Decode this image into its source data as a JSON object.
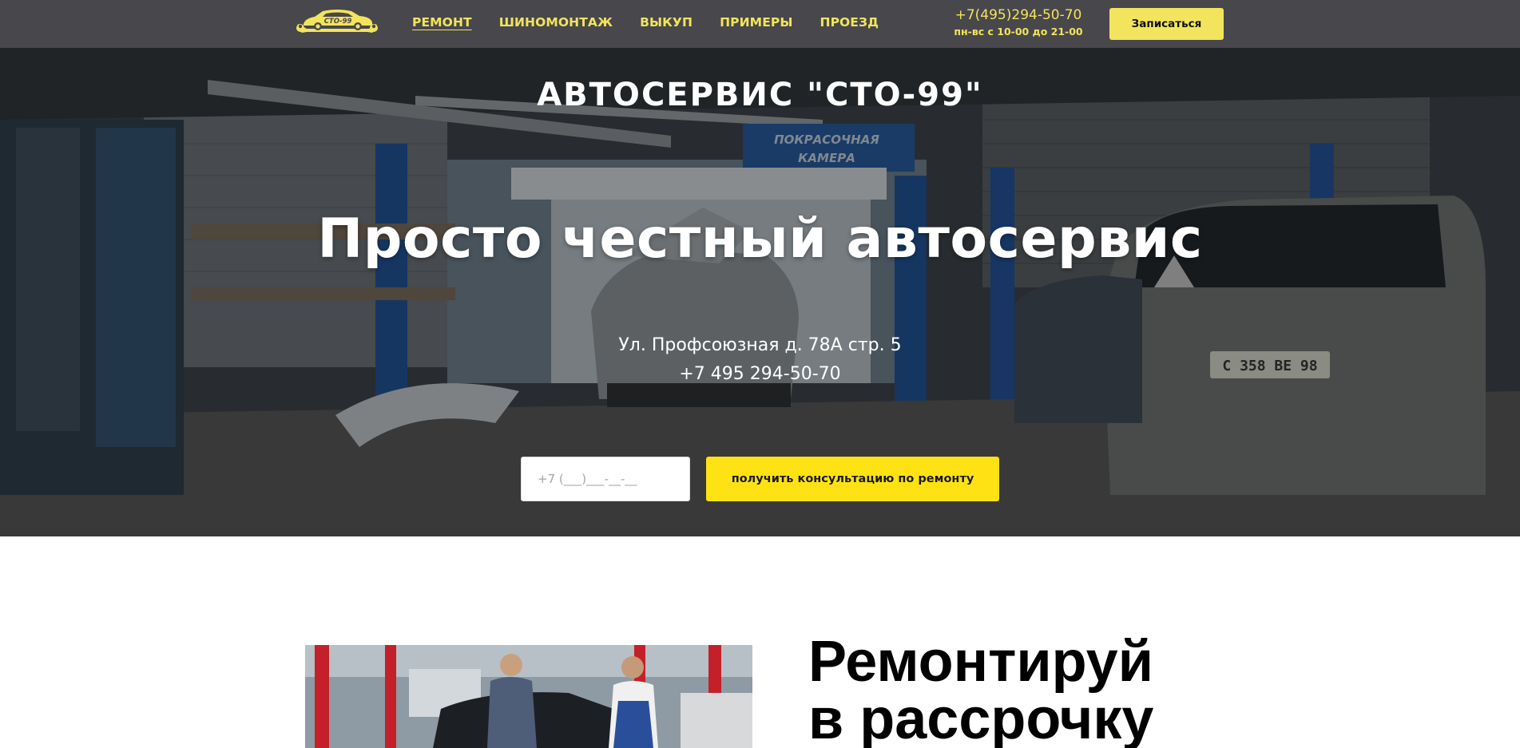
{
  "header": {
    "logo_text": "СТО-99",
    "nav": [
      {
        "label": "РЕМОНТ",
        "active": true
      },
      {
        "label": "ШИНОМОНТАЖ",
        "active": false
      },
      {
        "label": "ВЫКУП",
        "active": false
      },
      {
        "label": "ПРИМЕРЫ",
        "active": false
      },
      {
        "label": "ПРОЕЗД",
        "active": false
      }
    ],
    "phone": "+7(495)294-50-70",
    "hours": "пн-вс с 10-00 до 21-00",
    "signup_label": "Записаться"
  },
  "hero": {
    "top_title": "АВТОСЕРВИС \"СТО-99\"",
    "title": "Просто честный автосервис",
    "address": "Ул. Профсоюзная д. 78А стр. 5",
    "phone": "+7 495 294-50-70",
    "sign_text_line1": "ПОКРАСОЧНАЯ",
    "sign_text_line2": "КАМЕРА",
    "plate_text": "С 358 ВЕ 98",
    "phone_placeholder": "+7 (___)___-__-__",
    "consult_label": "получить консультацию по ремонту"
  },
  "promo": {
    "title_line1": "Ремонтируй",
    "title_line2": "в рассрочку"
  },
  "colors": {
    "header_bg": "#48474c",
    "accent_yellow": "#f2e45c",
    "button_yellow": "#ffe213"
  },
  "icons": {
    "logo": "car-wrench-logo-icon"
  }
}
